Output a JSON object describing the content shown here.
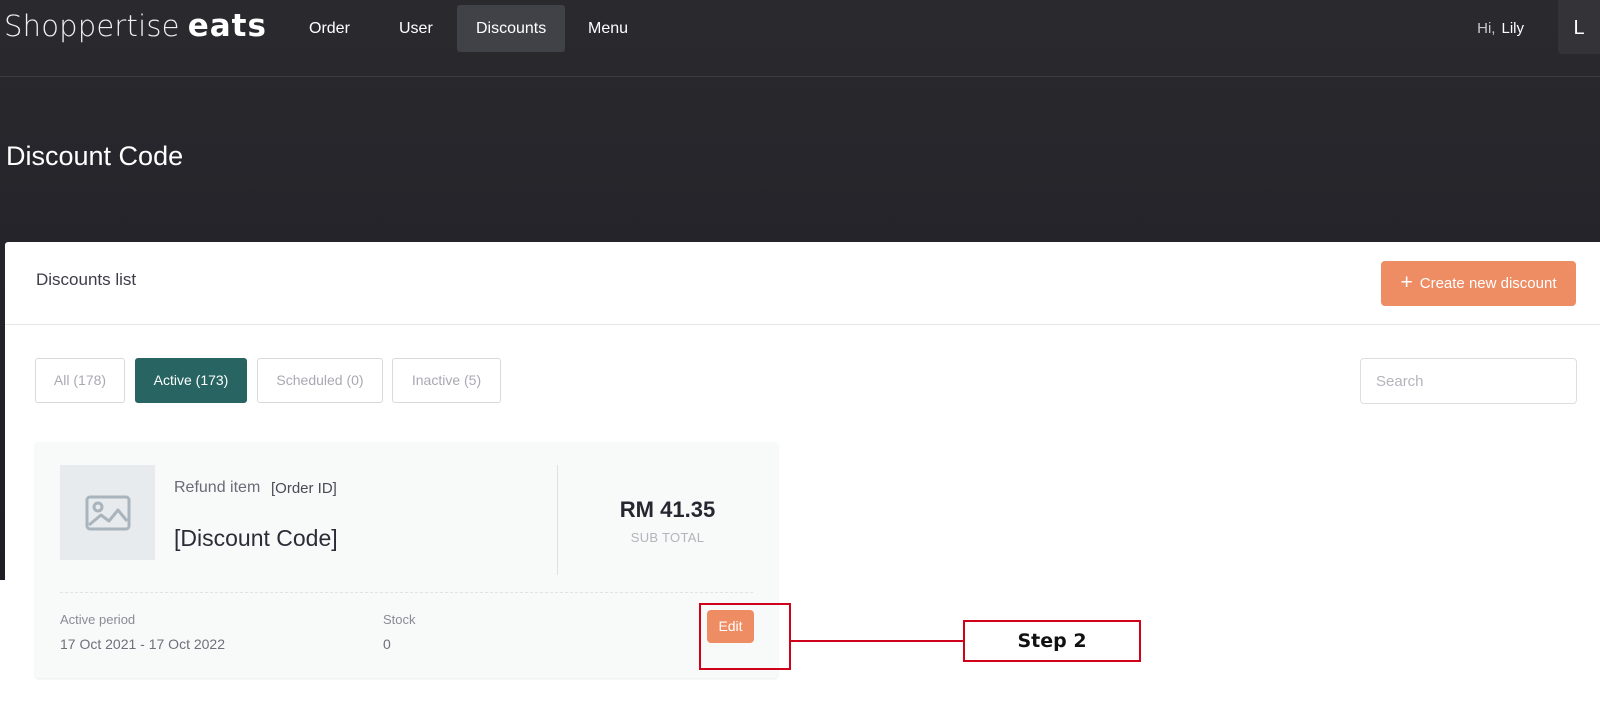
{
  "brand": {
    "name": "Shoppertise",
    "suffix": "eats"
  },
  "nav": {
    "items": [
      "Order",
      "User",
      "Discounts",
      "Menu"
    ],
    "active": "Discounts"
  },
  "user": {
    "greeting": "Hi,",
    "name": "Lily",
    "avatar_initial": "L"
  },
  "page": {
    "title": "Discount Code"
  },
  "panel": {
    "title": "Discounts list",
    "create_button": "Create new discount"
  },
  "filters": [
    {
      "label": "All (178)",
      "active": false
    },
    {
      "label": "Active (173)",
      "active": true
    },
    {
      "label": "Scheduled (0)",
      "active": false
    },
    {
      "label": "Inactive (5)",
      "active": false
    }
  ],
  "search": {
    "placeholder": "Search"
  },
  "discount_card": {
    "label": "Refund item",
    "order_id": "[Order ID]",
    "code": "[Discount Code]",
    "amount": "RM 41.35",
    "amount_label": "SUB TOTAL",
    "active_period_label": "Active period",
    "active_period": "17 Oct 2021 - 17 Oct 2022",
    "stock_label": "Stock",
    "stock": "0",
    "edit_button": "Edit"
  },
  "annotation": {
    "label": "Step 2"
  },
  "colors": {
    "accent": "#ee8c64",
    "active_filter": "#276462",
    "annotation": "#d0021b"
  },
  "icons": [
    "image-placeholder-icon",
    "plus-icon"
  ]
}
